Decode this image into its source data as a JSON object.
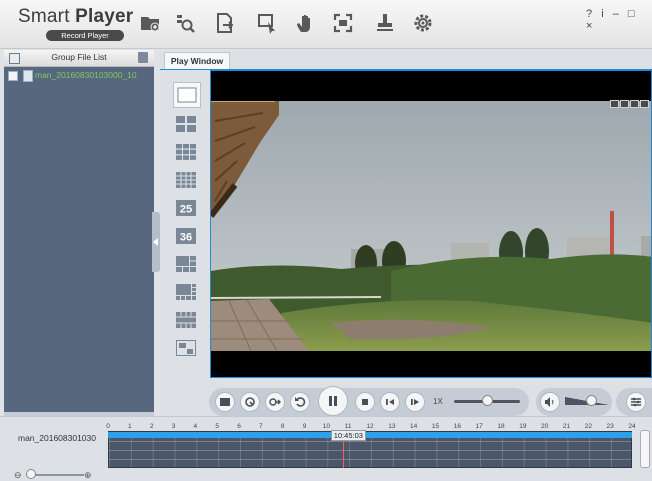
{
  "app": {
    "title_regular": "Smart ",
    "title_bold": "Player",
    "subtitle": "Record Player"
  },
  "toolbar": {
    "icons": [
      "open-folder-icon",
      "search-file-icon",
      "export-icon",
      "clip-icon",
      "hand-icon",
      "fullscreen-icon",
      "stamp-icon",
      "settings-icon"
    ]
  },
  "window_controls": {
    "help": "?",
    "info": "i",
    "minimize": "–",
    "maximize": "□",
    "close": "×"
  },
  "left_panel": {
    "title": "Group File List",
    "files": [
      {
        "name": "man_20160830103000_10",
        "color": "#7fc95e"
      }
    ]
  },
  "tabs": [
    {
      "label": "Play Window",
      "active": true
    }
  ],
  "layouts": [
    "1",
    "4",
    "9",
    "16",
    "25",
    "36",
    "1+5",
    "1+7",
    "1+12",
    "custom"
  ],
  "layout_labels": {
    "l25": "25",
    "l36": "36"
  },
  "playback": {
    "speed_label": "1X",
    "speed_level": 0.5,
    "volume_level": 0.6
  },
  "timeline": {
    "file_label": "man_201608301030",
    "hours": [
      "0",
      "1",
      "2",
      "3",
      "4",
      "5",
      "6",
      "7",
      "8",
      "9",
      "10",
      "11",
      "12",
      "13",
      "14",
      "15",
      "16",
      "17",
      "18",
      "19",
      "20",
      "21",
      "22",
      "23",
      "24"
    ],
    "current_time": "10:45:03",
    "accent_color": "#2ea0ea",
    "zoom_out": "⊖",
    "zoom_in": "⊕",
    "zoom_level": 0.0
  }
}
